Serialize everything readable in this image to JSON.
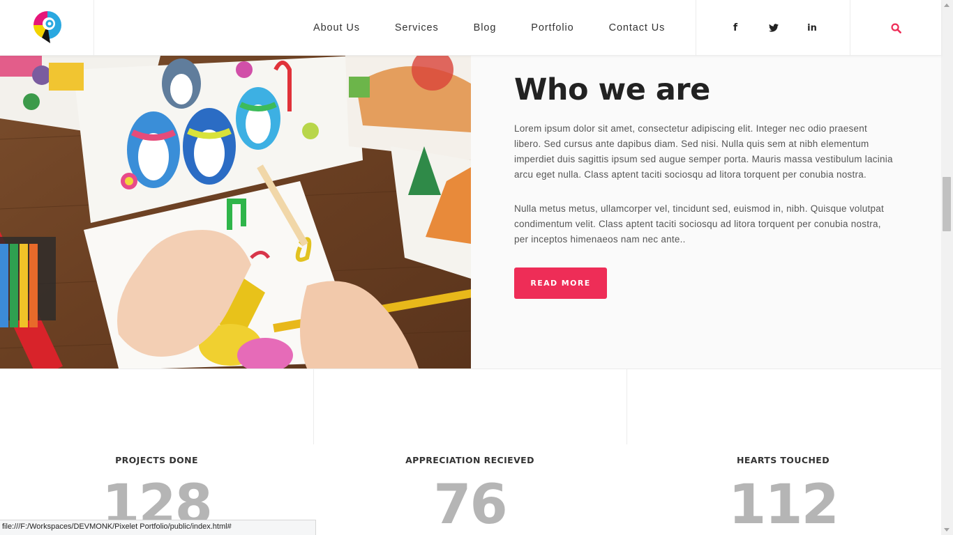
{
  "colors": {
    "accent": "#ee2d57",
    "heading": "#222222",
    "body_text": "#555555",
    "stat_number": "#b5b5b5"
  },
  "header": {
    "logo_icon": "pixelet-logo",
    "nav": [
      {
        "label": "About Us"
      },
      {
        "label": "Services"
      },
      {
        "label": "Blog"
      },
      {
        "label": "Portfolio"
      },
      {
        "label": "Contact Us"
      }
    ],
    "social": [
      {
        "label": "f",
        "icon": "facebook-icon"
      },
      {
        "icon": "twitter-icon"
      },
      {
        "label": "in",
        "icon": "linkedin-icon"
      }
    ],
    "search_icon": "search-icon"
  },
  "about": {
    "title": "Who we are",
    "paragraph_1": "Lorem ipsum dolor sit amet, consectetur adipiscing elit. Integer nec odio praesent libero. Sed cursus ante dapibus diam. Sed nisi. Nulla quis sem at nibh elementum imperdiet duis sagittis ipsum sed augue semper porta. Mauris massa vestibulum lacinia arcu eget nulla. Class aptent taciti sociosqu ad litora torquent per conubia nostra.",
    "paragraph_2": "Nulla metus metus, ullamcorper vel, tincidunt sed, euismod in, nibh. Quisque volutpat condimentum velit. Class aptent taciti sociosqu ad litora torquent per conubia nostra, per inceptos himenaeos nam nec ante..",
    "button_label": "READ MORE"
  },
  "stats": [
    {
      "label": "PROJECTS DONE",
      "value": "128"
    },
    {
      "label": "APPRECIATION RECIEVED",
      "value": "76"
    },
    {
      "label": "HEARTS TOUCHED",
      "value": "112"
    }
  ],
  "statusbar": {
    "url": "file:///F:/Workspaces/DEVMONK/Pixelet Portfolio/public/index.html#"
  }
}
